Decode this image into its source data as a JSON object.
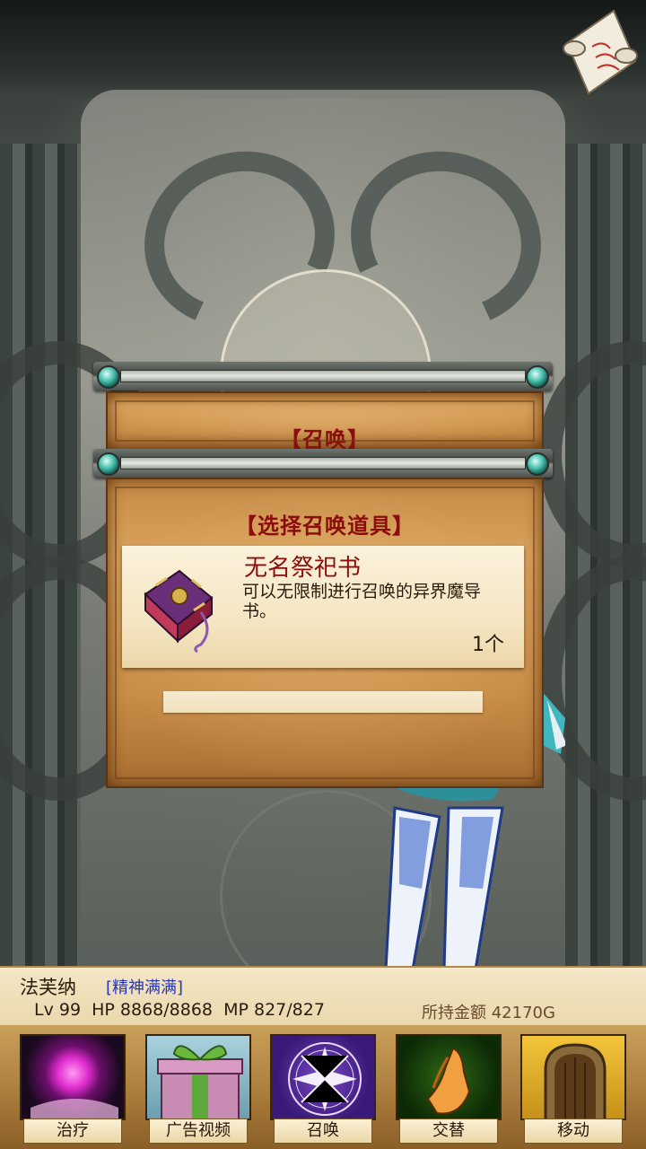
{
  "dialogs": {
    "summon_title": "【召唤】",
    "select_title": "【选择召唤道具】"
  },
  "item": {
    "name": "无名祭祀书",
    "description": "可以无限制进行召唤的异界魔导书。",
    "count": "1个",
    "icon": "grimoire-icon"
  },
  "status": {
    "name": "法芙纳",
    "state": "[精神满满]",
    "stats": "Lv 99  HP 8868/8868  MP 827/827",
    "gold": "所持金额 42170G"
  },
  "actions": [
    {
      "label": "治疗",
      "icon": "heal-orb-icon",
      "color": "#1a0a1f"
    },
    {
      "label": "广告视频",
      "icon": "gift-box-icon",
      "color": "#7fb1c4"
    },
    {
      "label": "召唤",
      "icon": "summon-circle-icon",
      "color": "#4a1f87"
    },
    {
      "label": "交替",
      "icon": "praying-hands-icon",
      "color": "#0d2a06"
    },
    {
      "label": "移动",
      "icon": "door-icon",
      "color": "#d8a41c"
    }
  ],
  "colors": {
    "title_red": "#8b0d0d",
    "state_blue": "#2636b8",
    "parchment": "#d9a25d"
  }
}
